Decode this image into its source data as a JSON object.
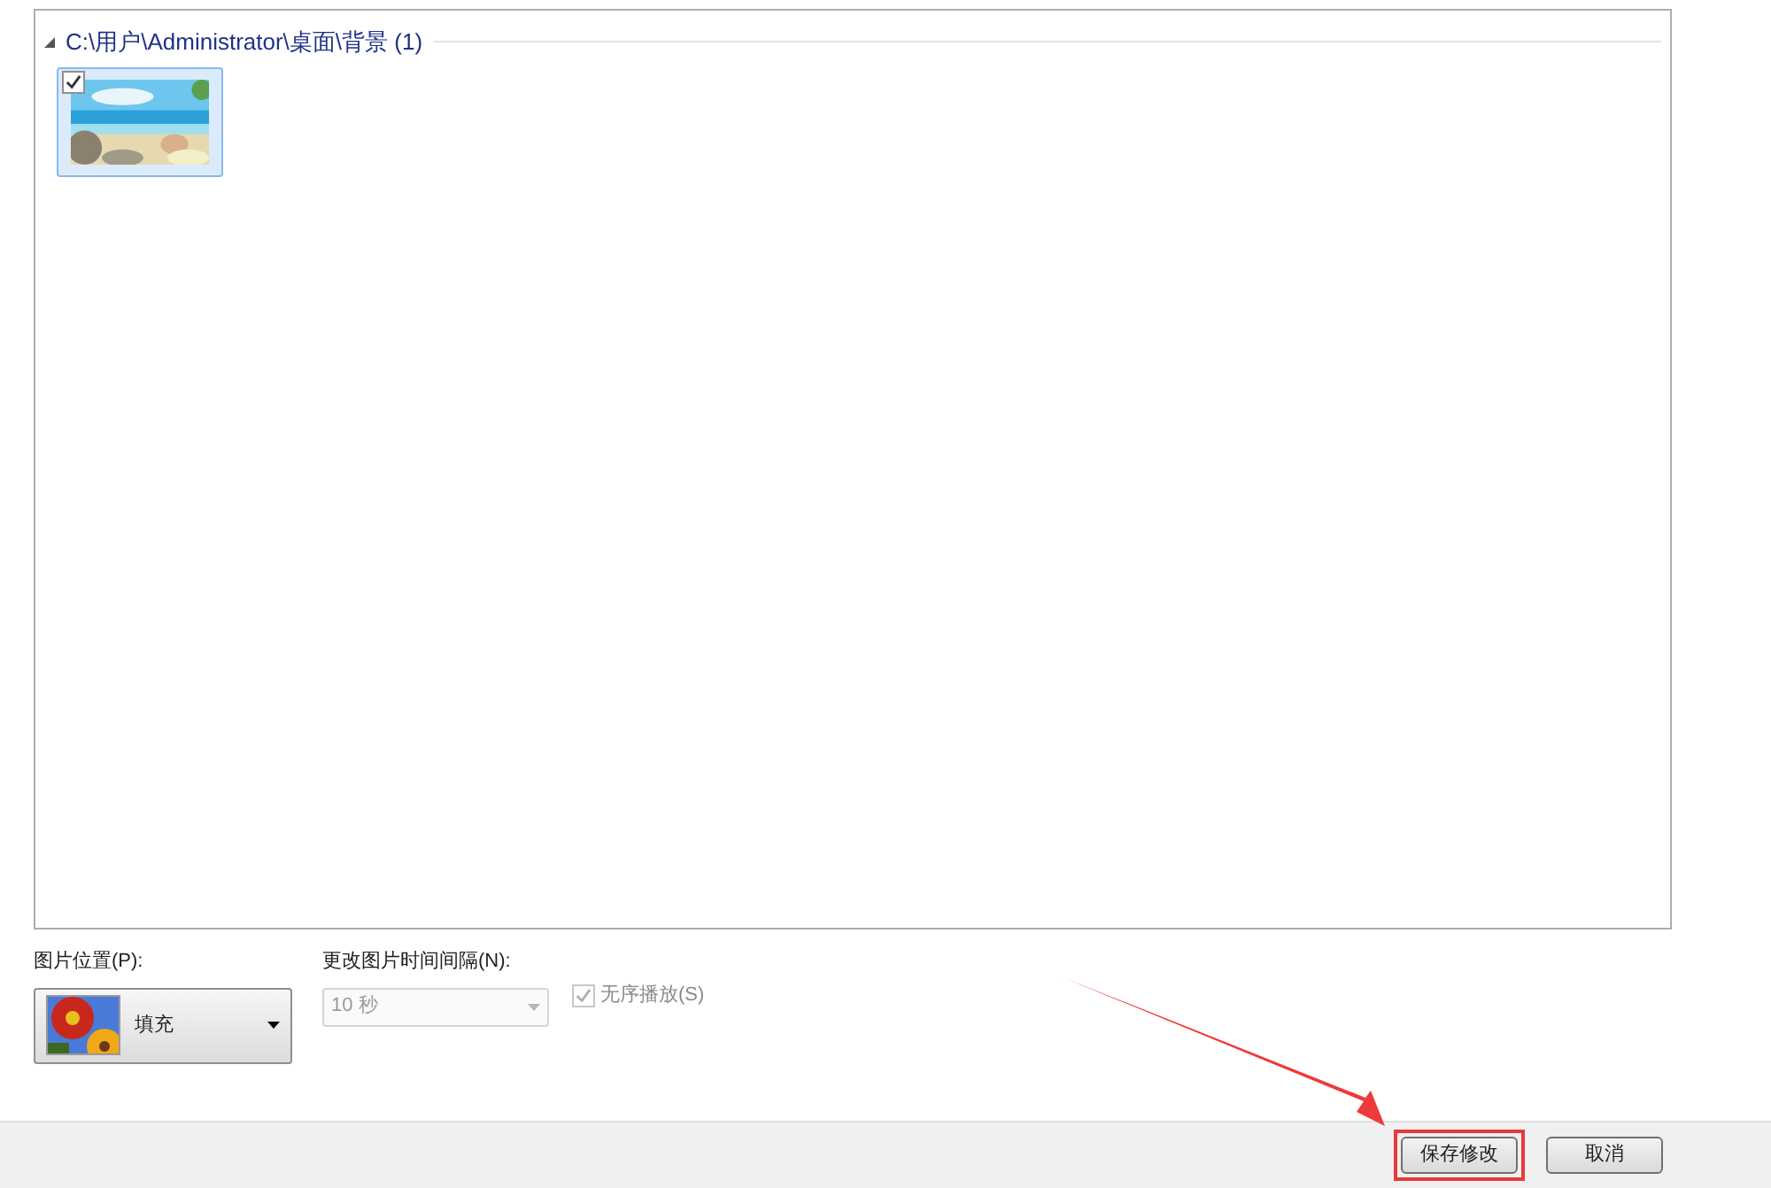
{
  "group": {
    "title": "C:\\用户\\Administrator\\桌面\\背景 (1)",
    "expanded": true,
    "items": [
      {
        "kind": "picture",
        "checked": true,
        "selected": true
      }
    ]
  },
  "position": {
    "label": "图片位置(P):",
    "value": "填充"
  },
  "interval": {
    "label": "更改图片时间间隔(N):",
    "value": "10 秒",
    "disabled": true
  },
  "shuffle": {
    "label": "无序播放(S)",
    "checked": true,
    "disabled": true
  },
  "buttons": [
    {
      "label": "保存修改",
      "highlighted": true
    },
    {
      "label": "取消",
      "highlighted": false
    }
  ]
}
